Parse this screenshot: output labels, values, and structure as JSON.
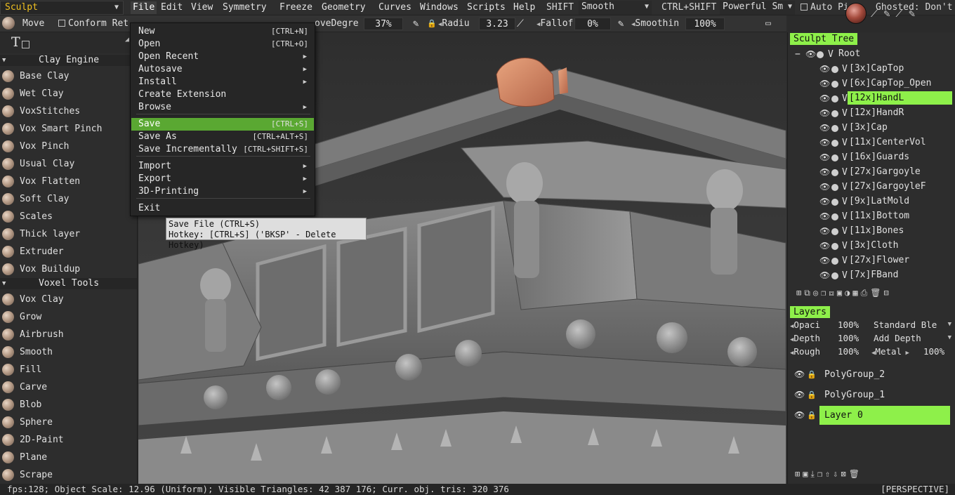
{
  "menubar": {
    "room": "Sculpt",
    "menus": [
      "File",
      "Edit",
      "View",
      "Symmetry",
      "Freeze",
      "Geometry",
      "Curves",
      "Windows",
      "Scripts",
      "Help"
    ],
    "shift_label": "SHIFT",
    "shift_value": "Smooth",
    "ctrl_shift_label": "CTRL+SHIFT",
    "ctrl_shift_value": "Powerful Sm",
    "auto_pick_label": "Auto Pi",
    "ghosted_label": "Ghosted: Don't"
  },
  "toolbar": {
    "move_label": "Move",
    "conform_label": "Conform Ret",
    "move_degree_label": "oveDegre",
    "move_degree_value": "37%",
    "radius_label": "Radiu",
    "radius_value": "3.23",
    "falloff_label": "Fallof",
    "falloff_value": "0%",
    "smoothing_label": "Smoothin",
    "smoothing_value": "100%"
  },
  "left_panel": {
    "sections": [
      {
        "title": "Clay Engine",
        "tools": [
          "Base Clay",
          "Wet Clay",
          "VoxStitches",
          "Vox Smart Pinch",
          "Vox Pinch",
          "Usual Clay",
          "Vox Flatten",
          "Soft Clay",
          "Scales",
          "Thick layer",
          "Extruder",
          "Vox Buildup"
        ]
      },
      {
        "title": "Voxel Tools",
        "tools": [
          "Vox Clay",
          "Grow",
          "Airbrush",
          "Smooth",
          "Fill",
          "Carve",
          "Blob",
          "Sphere",
          "2D-Paint",
          "Plane",
          "Scrape"
        ]
      }
    ]
  },
  "file_menu": {
    "items": [
      {
        "label": "New",
        "hotkey": "[CTRL+N]"
      },
      {
        "label": "Open",
        "hotkey": "[CTRL+O]"
      },
      {
        "label": "Open Recent",
        "submenu": "▶"
      },
      {
        "label": "Autosave",
        "submenu": "▶"
      },
      {
        "label": "Install",
        "submenu": "▶"
      },
      {
        "label": "Create Extension"
      },
      {
        "label": "Browse",
        "submenu": "▶"
      },
      {
        "label": "Save",
        "hotkey": "[CTRL+S]"
      },
      {
        "label": "Save As",
        "hotkey": "[CTRL+ALT+S]"
      },
      {
        "label": "Save Incrementally",
        "hotkey": "[CTRL+SHIFT+S]"
      },
      {
        "label": "Import",
        "submenu": "▶"
      },
      {
        "label": "Export",
        "submenu": "▶"
      },
      {
        "label": "3D-Printing",
        "submenu": "▶"
      },
      {
        "label": "Exit"
      }
    ],
    "selected": "Save"
  },
  "tooltip": {
    "line1": "Save File (CTRL+S)",
    "line2": "Hotkey: [CTRL+S]  ('BKSP' - Delete Hotkey)"
  },
  "sculpt_tree": {
    "title": "Sculpt Tree",
    "root": "Root",
    "items": [
      "[3x]CapTop",
      "[6x]CapTop_Open",
      "[12x]HandL",
      "[12x]HandR",
      "[3x]Cap",
      "[11x]CenterVol",
      "[16x]Guards",
      "[27x]Gargoyle",
      "[27x]GargoyleF",
      "[9x]LatMold",
      "[11x]Bottom",
      "[11x]Bones",
      "[3x]Cloth",
      "[27x]Flower",
      "[7x]FBand"
    ],
    "selected": "[12x]HandL"
  },
  "layers": {
    "title": "Layers",
    "opacity_label": "Opaci",
    "opacity_value": "100%",
    "blend_mode": "Standard Ble",
    "depth_label": "Depth",
    "depth_value": "100%",
    "depth_mode": "Add Depth",
    "rough_label": "Rough",
    "rough_value": "100%",
    "metal_label": "Metal",
    "metal_value": "100%",
    "items": [
      "PolyGroup_2",
      "PolyGroup_1",
      "Layer 0"
    ],
    "selected": "Layer 0"
  },
  "statusbar": {
    "text": "fps:128;   Object Scale: 12.96 (Uniform); Visible Triangles: 42 387 176; Curr. obj. tris: 320 376",
    "view_mode": "[PERSPECTIVE]"
  },
  "colors": {
    "accent_green": "#8ef04a",
    "menu_highlight": "#5aa832",
    "room_text": "#f0c020"
  }
}
